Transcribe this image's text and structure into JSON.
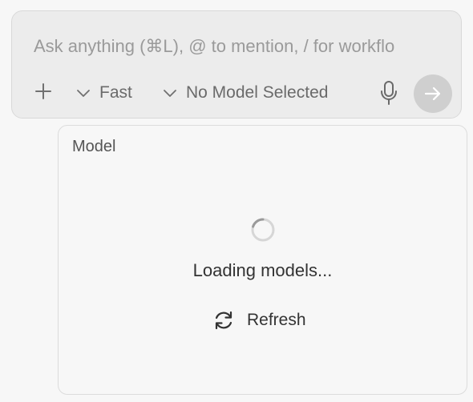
{
  "composer": {
    "placeholder": "Ask anything (⌘L), @ to mention, / for workflo",
    "value": "",
    "mode_label": "Fast",
    "model_label": "No Model Selected"
  },
  "icons": {
    "add": "plus-icon",
    "mode_chevron": "chevron-down-icon",
    "model_chevron": "chevron-down-icon",
    "mic": "microphone-icon",
    "send": "arrow-right-icon",
    "spinner": "spinner-icon",
    "refresh": "refresh-icon"
  },
  "popover": {
    "title": "Model",
    "loading_text": "Loading models...",
    "refresh_label": "Refresh"
  },
  "colors": {
    "composer_bg": "#ececec",
    "send_button_bg": "#cfcfcf",
    "popover_bg": "#f7f7f7"
  }
}
